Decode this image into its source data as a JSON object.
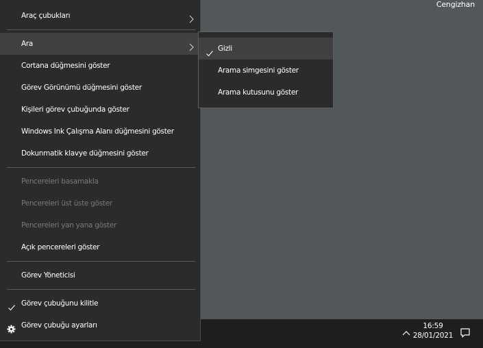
{
  "desktop": {
    "user_label": "Cengizhan"
  },
  "menu": {
    "items": [
      {
        "label": "Araç çubukları"
      },
      {
        "label": "Ara"
      },
      {
        "label": "Cortana düğmesini göster"
      },
      {
        "label": "Görev Görünümü düğmesini göster"
      },
      {
        "label": "Kişileri görev çubuğunda göster"
      },
      {
        "label": "Windows Ink Çalışma Alanı düğmesini göster"
      },
      {
        "label": "Dokunmatik klavye düğmesini göster"
      },
      {
        "label": "Pencereleri basamakla"
      },
      {
        "label": "Pencereleri üst üste göster"
      },
      {
        "label": "Pencereleri yan yana göster"
      },
      {
        "label": "Açık pencereleri göster"
      },
      {
        "label": "Görev Yöneticisi"
      },
      {
        "label": "Görev çubuğunu kilitle"
      },
      {
        "label": "Görev çubuğu ayarları"
      }
    ]
  },
  "submenu": {
    "items": [
      {
        "label": "Gizli"
      },
      {
        "label": "Arama simgesini göster"
      },
      {
        "label": "Arama kutusunu göster"
      }
    ]
  },
  "taskbar": {
    "time": "16:59",
    "date": "28/01/2021"
  },
  "colors": {
    "desktop_bg": "#52575a",
    "menu_bg": "#2b2b2b",
    "menu_hover": "#414141",
    "taskbar_bg": "#1f1f1f",
    "disabled_text": "#7a7a7a"
  }
}
